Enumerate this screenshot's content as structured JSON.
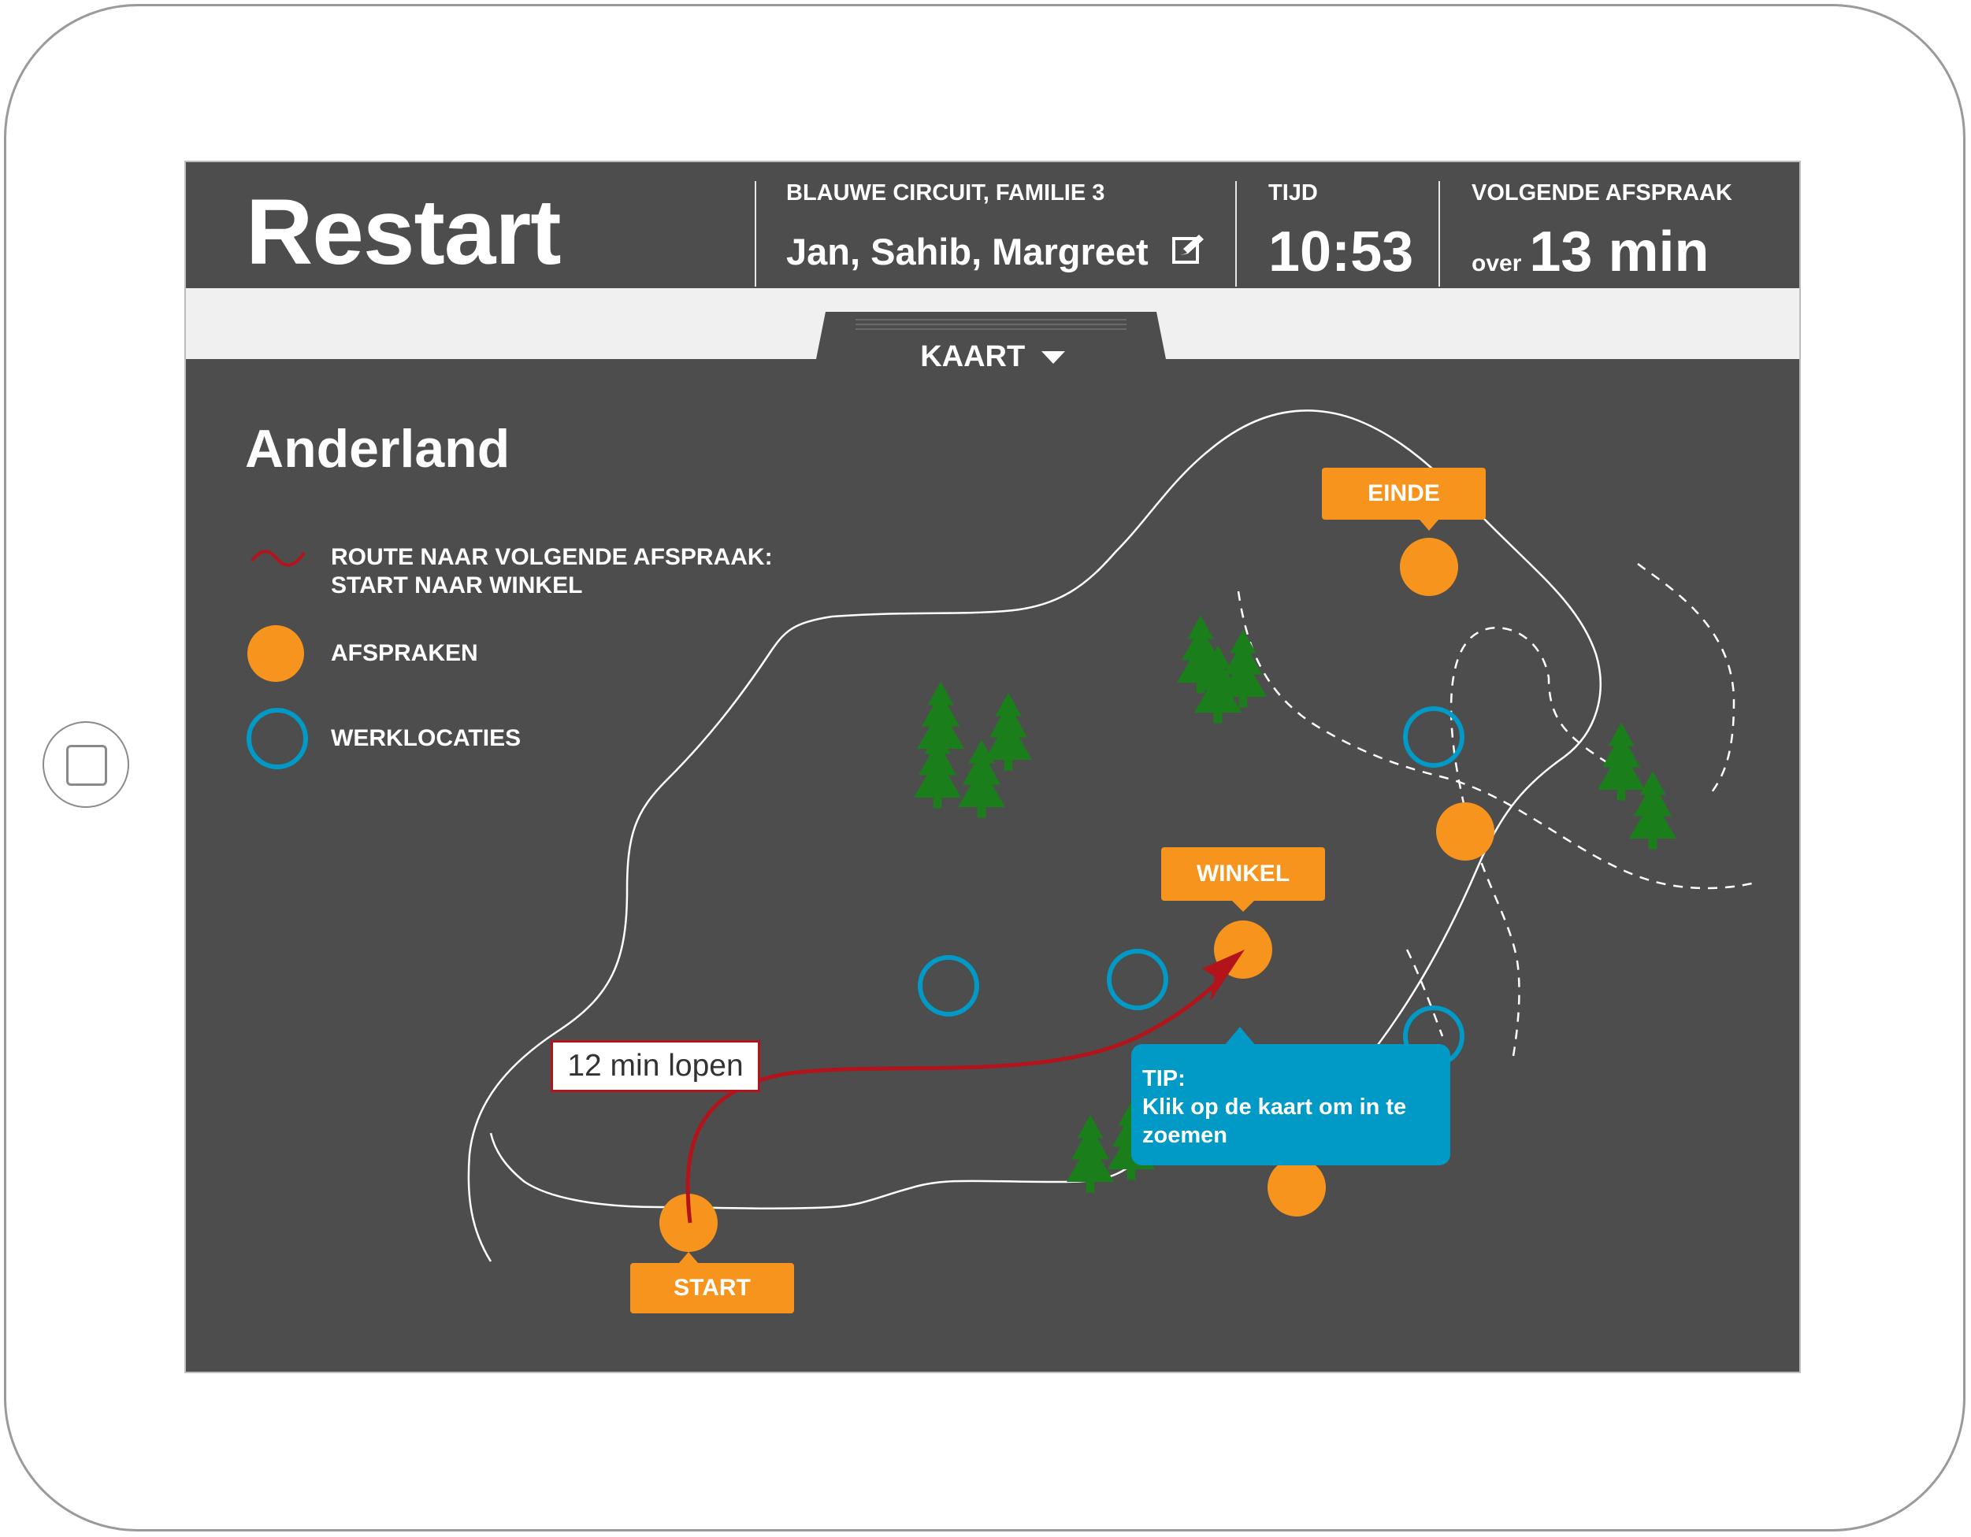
{
  "app": {
    "title": "Restart"
  },
  "header": {
    "team_label": "BLAUWE CIRCUIT, FAMILIE 3",
    "team_members": "Jan, Sahib, Margreet",
    "time_label": "TIJD",
    "time_value": "10:53",
    "next_label": "VOLGENDE AFSPRAAK",
    "next_prefix": "over",
    "next_value": "13 min"
  },
  "tab": {
    "label": "KAART",
    "icon": "caret-down-icon"
  },
  "map": {
    "title": "Anderland",
    "legend": {
      "route": "ROUTE NAAR VOLGENDE AFSPRAAK:",
      "route_detail": "START NAAR WINKEL",
      "appointments": "AFSPRAKEN",
      "worklocations": "WERKLOCATIES"
    },
    "markers": {
      "start": "START",
      "shop": "WINKEL",
      "end": "EINDE"
    },
    "route_time": "12 min lopen",
    "tip_title": "TIP:",
    "tip_text": "Klik op de kaart om in te zoemen"
  },
  "colors": {
    "background": "#4d4d4d",
    "appointment": "#f7941d",
    "worklocation": "#0199c6",
    "route": "#b3131b",
    "tree": "#1a7f1a",
    "tabbar": "#f0f0f0"
  }
}
